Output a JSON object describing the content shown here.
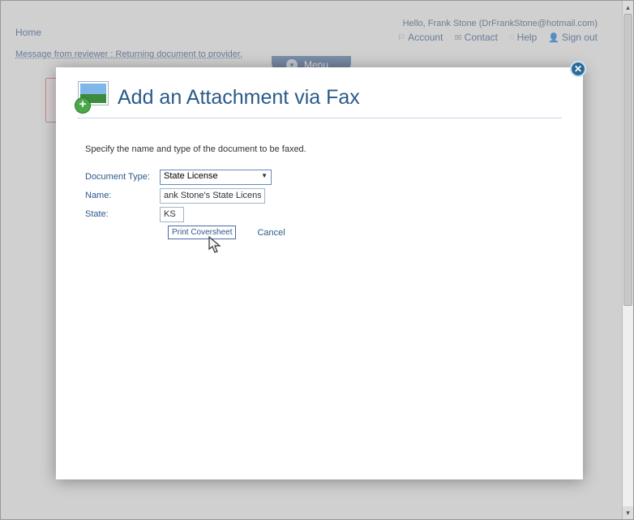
{
  "page": {
    "greeting": "Hello, Frank Stone (DrFrankStone@hotmail.com)",
    "home_link": "Home",
    "reviewer_message": "Message from reviewer : Returning document to provider.",
    "menu_label": "Menu",
    "nav": {
      "account": "Account",
      "contact": "Contact",
      "help": "Help",
      "signout": "Sign out"
    }
  },
  "modal": {
    "title": "Add an Attachment via Fax",
    "instruction": "Specify the name and type of the document to be faxed.",
    "close_icon_label": "✕",
    "labels": {
      "document_type": "Document Type:",
      "name": "Name:",
      "state": "State:"
    },
    "values": {
      "document_type": "State License",
      "name": "ank Stone's State License",
      "state": "KS"
    },
    "actions": {
      "print": "Print Coversheet",
      "cancel": "Cancel"
    }
  }
}
